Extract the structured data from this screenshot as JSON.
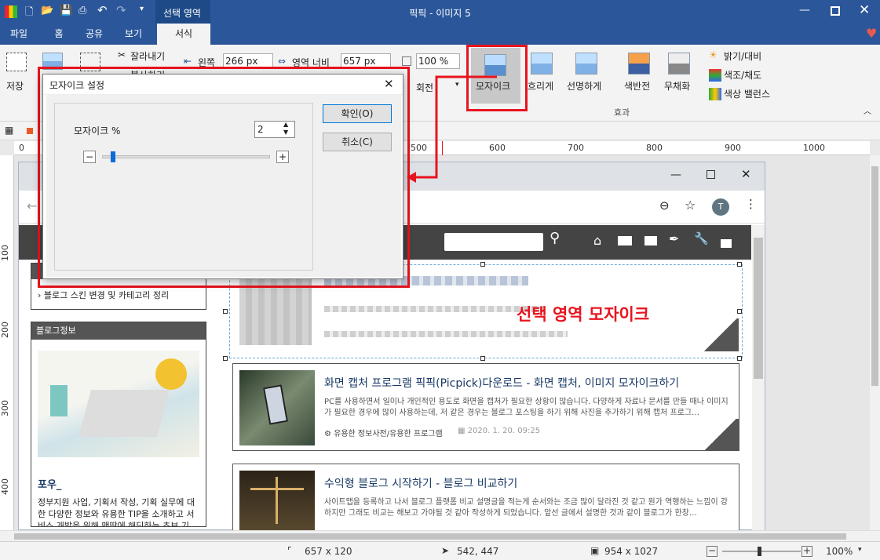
{
  "titlebar": {
    "title": "픽픽 - 이미지 5",
    "context_tab": "선택 영역"
  },
  "tabs": [
    "파일",
    "홈",
    "공유",
    "보기",
    "서식"
  ],
  "ribbon": {
    "save": "저장",
    "cut": "잘라내기",
    "copy": "복사하기",
    "left_label": "왼쪽",
    "left_value": "266 px",
    "width_label": "영역 너비",
    "width_value": "657 px",
    "zoom_value": "100 %",
    "rotate": "회전",
    "mosaic": "모자이크",
    "blur": "흐리게",
    "sharpen": "선명하게",
    "invert": "색반전",
    "grayscale": "무채화",
    "brightness": "밝기/대비",
    "hue": "색조/채도",
    "color_balance": "색상 밸런스",
    "effects_group": "효과"
  },
  "ruler": {
    "h": [
      "0",
      "500",
      "600",
      "700",
      "800",
      "900",
      "1000"
    ],
    "v": [
      "100",
      "200",
      "300",
      "400"
    ]
  },
  "dialog": {
    "title": "모자이크 설정",
    "field_label": "모자이크 %",
    "value": "2",
    "ok": "확인(O)",
    "cancel": "취소(C)",
    "slider_level": 0.05
  },
  "annotation": "선택 영역 모자이크",
  "blog": {
    "sidebar_link": "블로그 스킨 변경 및 카테고리 정리",
    "info_title": "블로그정보",
    "author": "포우_",
    "desc": "정부지원 사업, 기획서 작성, 기획 실무에 대한 다양한 정보와 유용한 TIP을 소개하고 서비스 개발을 위해 맨땅에 해딩하는 초보 기",
    "posts": [
      {
        "title": "화면 캡처 프로그램 픽픽(Picpick)다운로드 - 화면 캡처, 이미지 모자이크하기",
        "excerpt": "PC를 사용하면서 일이나 개인적인 용도로 화면을 캡처가 필요한 상황이 많습니다. 다양하게 자료나 문서를 만들 때나 이미지가 필요한 경우에 많이 사용하는데, 저 같은 경우는 블로그 포스팅을 하기 위해 사진을 추가하기 위해 캡처 프로그…",
        "category": "유용한 정보사전/유용한 프로그램",
        "date": "2020. 1. 20. 09:25"
      },
      {
        "title": "수익형 블로그 시작하기 - 블로그 비교하기",
        "excerpt": "사이트맵을 등록하고 나서 블로그 플랫폼 비교 설명글을 적는게 순서와는 조금 많이 달라진 것 같고 뭔가 역행하는 느낌이 강하지만 그래도 비교는 해보고 가야될 것 같아 작성하게 되었습니다. 앞선 글에서 설명한 것과 같이 블로그가 한창…"
      }
    ]
  },
  "status": {
    "selection": "657 x 120",
    "cursor": "542, 447",
    "image": "954 x 1027",
    "zoom": "100%"
  },
  "colors": {
    "accent": "#2b579a",
    "highlight": "#e8141e",
    "mosaic_active": "#c8c8c8"
  }
}
